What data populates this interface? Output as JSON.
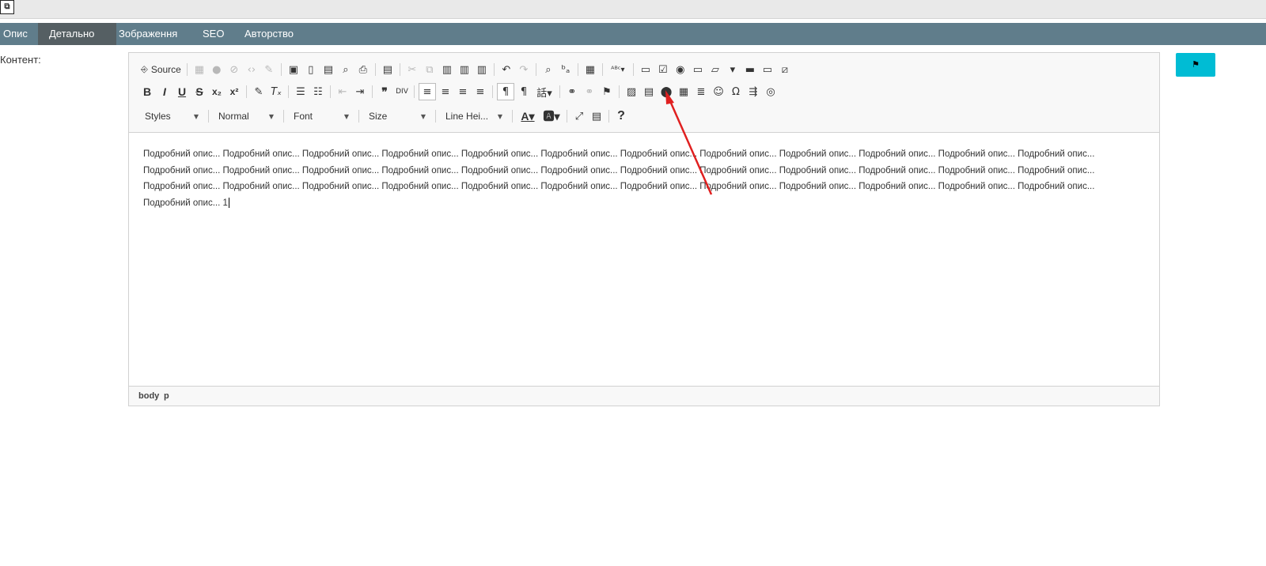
{
  "window": {
    "icon": "restore-window-icon",
    "icon_glyph": "⧉"
  },
  "tabs": [
    {
      "label": "Опис"
    },
    {
      "label": "Детально"
    },
    {
      "label": "Зображення"
    },
    {
      "label": "SEO"
    },
    {
      "label": "Авторство"
    }
  ],
  "active_tab": "Детально",
  "field_label": "Контент:",
  "save_button_icon": "save-flag-icon",
  "editor": {
    "source_label": "Source",
    "combos": {
      "styles": "Styles",
      "format": "Normal",
      "font": "Font",
      "size": "Size",
      "line_height": "Line Hei..."
    },
    "help_label": "?",
    "content_text": "Подробний опис... Подробний опис... Подробний опис... Подробний опис... Подробний опис... Подробний опис... Подробний опис... Подробний опис... Подробний опис... Подробний опис... Подробний опис... Подробний опис... Подробний опис... Подробний опис... Подробний опис... Подробний опис... Подробний опис... Подробний опис... Подробний опис... Подробний опис... Подробний опис... Подробний опис... Подробний опис... Подробний опис... Подробний опис... Подробний опис... Подробний опис... Подробний опис... Подробний опис... Подробний опис... Подробний опис... Подробний опис... Подробний опис... Подробний опис... Подробний опис... Подробний опис... Подробний опис... 1",
    "status_path": [
      "body",
      "p"
    ]
  },
  "colors": {
    "tabbar": "#607d8b",
    "active_tab": "#555f63",
    "save_button": "#00bcd4",
    "annotation_arrow": "#e02020"
  }
}
